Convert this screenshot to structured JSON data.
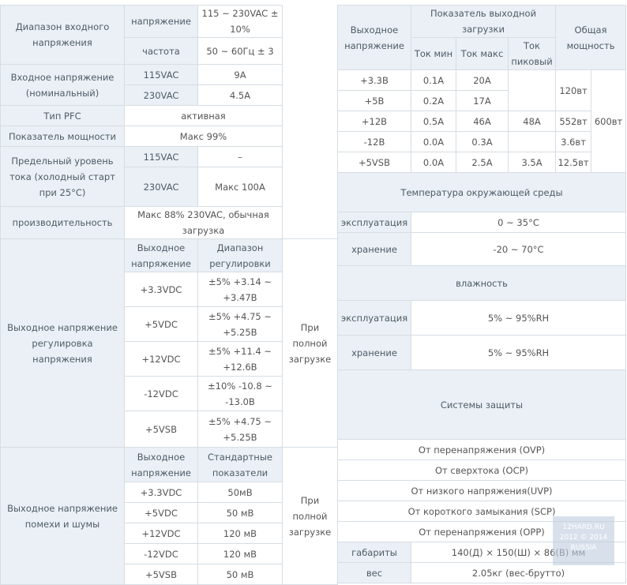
{
  "left_rows": [
    [
      {
        "t": "Диапазон входного напряжения",
        "rs": 2,
        "h": true
      },
      {
        "t": "напряжение",
        "h": true
      },
      {
        "t": "115 ~ 230VAC ± 10%"
      }
    ],
    [
      {
        "t": "частота",
        "h": true
      },
      {
        "t": "50 ~ 60Гц ± 3"
      }
    ],
    [
      {
        "t": "Входное напряжение (номинальный)",
        "rs": 2,
        "h": true
      },
      {
        "t": "115VAC",
        "h": true
      },
      {
        "t": "9A"
      }
    ],
    [
      {
        "t": "230VAC",
        "h": true
      },
      {
        "t": "4.5A"
      }
    ],
    [
      {
        "t": "Тип PFC",
        "h": true
      },
      {
        "t": "активная",
        "cs": 2
      }
    ],
    [
      {
        "t": "Показатель мощности",
        "h": true
      },
      {
        "t": "Макс 99%",
        "cs": 2
      }
    ],
    [
      {
        "t": "Предельный уровень тока (холодный старт при 25°C)",
        "rs": 2,
        "h": true
      },
      {
        "t": "115VAC",
        "h": true
      },
      {
        "t": "–"
      }
    ],
    [
      {
        "t": "230VAC",
        "h": true
      },
      {
        "t": "Макс 100A"
      }
    ],
    [
      {
        "t": "производительность",
        "h": true
      },
      {
        "t": "Макс 88% 230VAC, обычная загрузка",
        "cs": 2
      }
    ],
    [
      {
        "t": "Выходное напряжение регулировка напряжения",
        "rs": 6,
        "h": true
      },
      {
        "t": "Выходное напряжение",
        "h": true
      },
      {
        "t": "Диапазон регулировки",
        "h": true
      },
      {
        "t": "При полной загрузке",
        "rs": 6
      }
    ],
    [
      {
        "t": "+3.3VDC"
      },
      {
        "t": "±5% +3.14 ~ +3.47В"
      }
    ],
    [
      {
        "t": "+5VDC"
      },
      {
        "t": "±5% +4.75 ~ +5.25В"
      }
    ],
    [
      {
        "t": "+12VDC"
      },
      {
        "t": "±5% +11.4 ~ +12.6В"
      }
    ],
    [
      {
        "t": "-12VDC"
      },
      {
        "t": "±10% -10.8 ~ -13.0В"
      }
    ],
    [
      {
        "t": "+5VSB"
      },
      {
        "t": "±5% +4.75 ~ +5.25В"
      }
    ],
    [
      {
        "t": "Выходное напряжение помехи и шумы",
        "rs": 6,
        "h": true
      },
      {
        "t": "Выходное напряжение",
        "h": true
      },
      {
        "t": "Стандартные показатели",
        "h": true
      },
      {
        "t": "При полной загрузке",
        "rs": 6
      }
    ],
    [
      {
        "t": "+3.3VDC"
      },
      {
        "t": "50мВ"
      }
    ],
    [
      {
        "t": "+5VDC"
      },
      {
        "t": "50 мВ"
      }
    ],
    [
      {
        "t": "+12VDC"
      },
      {
        "t": "120 мВ"
      }
    ],
    [
      {
        "t": "-12VDC"
      },
      {
        "t": "120 мВ"
      }
    ],
    [
      {
        "t": "+5VSB"
      },
      {
        "t": "50 мВ"
      }
    ]
  ],
  "right_rows": [
    [
      {
        "t": "Выходное напряжение",
        "rs": 2,
        "h": true
      },
      {
        "t": "Показатель выходной загрузки",
        "cs": 3,
        "h": true
      },
      {
        "t": "Общая мощность",
        "rs": 2,
        "cs": 2,
        "h": true
      }
    ],
    [
      {
        "t": "Ток мин",
        "h": true
      },
      {
        "t": "Ток макс",
        "h": true
      },
      {
        "t": "Ток пиковый",
        "h": true
      }
    ],
    [
      {
        "t": "+3.3В"
      },
      {
        "t": "0.1A"
      },
      {
        "t": "20A"
      },
      {
        "t": "",
        "rs": 2
      },
      {
        "t": "120вт",
        "rs": 2
      },
      {
        "t": "600вт",
        "rs": 5
      }
    ],
    [
      {
        "t": "+5В"
      },
      {
        "t": "0.2A"
      },
      {
        "t": "17A"
      }
    ],
    [
      {
        "t": "+12В"
      },
      {
        "t": "0.5A"
      },
      {
        "t": "46A"
      },
      {
        "t": "48A"
      },
      {
        "t": "552вт"
      }
    ],
    [
      {
        "t": "-12В"
      },
      {
        "t": "0.0A"
      },
      {
        "t": "0.3A"
      },
      {
        "t": ""
      },
      {
        "t": "3.6вт"
      }
    ],
    [
      {
        "t": "+5VSB"
      },
      {
        "t": "0.0A"
      },
      {
        "t": "2.5A"
      },
      {
        "t": "3.5A"
      },
      {
        "t": "12.5вт"
      }
    ],
    [
      {
        "t": "Температура окружающей среды",
        "cs": 6,
        "h": true
      }
    ],
    [
      {
        "t": "эксплуатация",
        "h": true
      },
      {
        "t": "0 ~ 35°C",
        "cs": 5
      }
    ],
    [
      {
        "t": "хранение",
        "h": true
      },
      {
        "t": "-20 ~ 70°C",
        "cs": 5
      }
    ],
    [
      {
        "t": "влажность",
        "cs": 6,
        "h": true
      }
    ],
    [
      {
        "t": "эксплуатация",
        "h": true
      },
      {
        "t": "5% ~ 95%RH",
        "cs": 5
      }
    ],
    [
      {
        "t": "хранение",
        "h": true
      },
      {
        "t": "5% ~ 95%RH",
        "cs": 5
      }
    ],
    [
      {
        "t": "Системы защиты",
        "cs": 6,
        "h": true
      }
    ],
    [
      {
        "t": "От перенапряжения (OVP)",
        "cs": 6
      }
    ],
    [
      {
        "t": "От сверхтока (OCP)",
        "cs": 6
      }
    ],
    [
      {
        "t": "От низкого напряжения(UVP)",
        "cs": 6
      }
    ],
    [
      {
        "t": "От короткого замыкания (SCP)",
        "cs": 6
      }
    ],
    [
      {
        "t": "От перенапряжения (OPP)",
        "cs": 6
      }
    ],
    [
      {
        "t": "габариты",
        "h": true
      },
      {
        "t": "140(Д) × 150(Ш) × 86(В) мм",
        "cs": 5
      }
    ],
    [
      {
        "t": "вес",
        "h": true
      },
      {
        "t": "2.05кг (вес-брутто)",
        "cs": 5
      }
    ]
  ],
  "watermark": "12HARD.RU 2012 © 2014 RUSSIA"
}
